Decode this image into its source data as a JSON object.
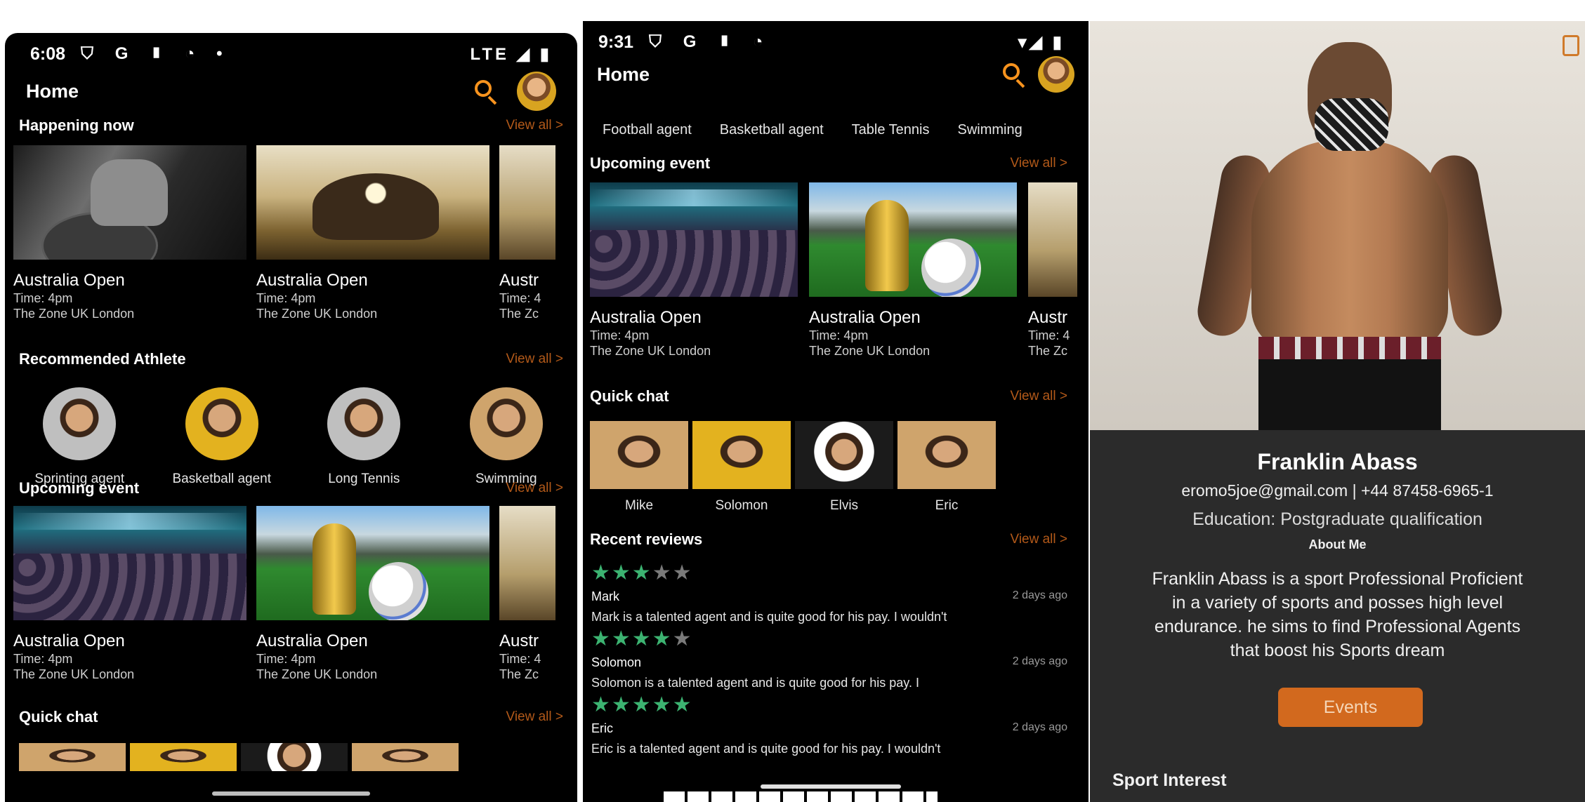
{
  "phone1": {
    "status": {
      "time": "6:08",
      "icons": "⛉ G ▮ ◔ •",
      "network": "LTE ◢ ▮"
    },
    "appbar": {
      "title": "Home"
    },
    "happening": {
      "title": "Happening now",
      "view_all": "View all  >",
      "cards": [
        {
          "title": "Australia Open",
          "time": "Time: 4pm",
          "place": "The Zone UK London"
        },
        {
          "title": "Australia Open",
          "time": "Time: 4pm",
          "place": "The Zone UK London"
        },
        {
          "title": "Austr",
          "time": "Time: 4",
          "place": "The Zc"
        }
      ]
    },
    "recommended": {
      "title": "Recommended Athlete",
      "view_all": "View all  >",
      "athletes": [
        {
          "label": "Sprinting agent"
        },
        {
          "label": "Basketball agent"
        },
        {
          "label": "Long Tennis"
        },
        {
          "label": "Swimming"
        }
      ]
    },
    "upcoming": {
      "title": "Upcoming event",
      "view_all": "View all  >",
      "cards": [
        {
          "title": "Australia Open",
          "time": "Time: 4pm",
          "place": "The Zone UK London"
        },
        {
          "title": "Australia Open",
          "time": "Time: 4pm",
          "place": "The Zone UK London"
        },
        {
          "title": "Austr",
          "time": "Time: 4",
          "place": "The Zc"
        }
      ]
    },
    "quick_chat": {
      "title": "Quick chat",
      "view_all": "View all  >"
    }
  },
  "phone2": {
    "status": {
      "time": "9:31",
      "icons": "⛉ G ▮ ◔",
      "network": "▾◢ ▮"
    },
    "appbar": {
      "title": "Home"
    },
    "tabs": [
      "Football agent",
      "Basketball agent",
      "Table Tennis",
      "Swimming"
    ],
    "upcoming": {
      "title": "Upcoming event",
      "view_all": "View all  >",
      "cards": [
        {
          "title": "Australia Open",
          "time": "Time: 4pm",
          "place": "The Zone UK London"
        },
        {
          "title": "Australia Open",
          "time": "Time: 4pm",
          "place": "The Zone UK London"
        },
        {
          "title": "Austr",
          "time": "Time: 4",
          "place": "The Zc"
        }
      ]
    },
    "quick_chat": {
      "title": "Quick chat",
      "view_all": "View all  >",
      "people": [
        "Mike",
        "Solomon",
        "Elvis",
        "Eric"
      ]
    },
    "reviews": {
      "title": "Recent reviews",
      "view_all": "View all  >",
      "items": [
        {
          "name": "Mark",
          "date": "2 days ago",
          "rating": 3,
          "text": "Mark is a talented agent and is quite good for his pay. I wouldn't"
        },
        {
          "name": "Solomon",
          "date": "2 days ago",
          "rating": 4,
          "text": "Solomon is a talented agent and is quite good for his pay. I"
        },
        {
          "name": "Eric",
          "date": "2 days ago",
          "rating": 5,
          "text": "Eric is a talented agent and is quite good for his pay. I wouldn't"
        }
      ]
    }
  },
  "phone3": {
    "name": "Franklin Abass",
    "contact": "eromo5joe@gmail.com | +44 87458-6965-1",
    "education": "Education: Postgraduate qualification",
    "about_heading": "About Me",
    "about_lines": [
      "Franklin Abass is a sport Professional Proficient",
      "in a variety of sports and posses high level",
      "endurance. he sims to find Professional Agents",
      "that boost his Sports dream"
    ],
    "events_button": "Events",
    "sport_interest": "Sport Interest"
  },
  "colors": {
    "accent": "#d2691e",
    "star_on": "#3cb371",
    "star_off": "#7a7a7a",
    "background": "#000000"
  }
}
